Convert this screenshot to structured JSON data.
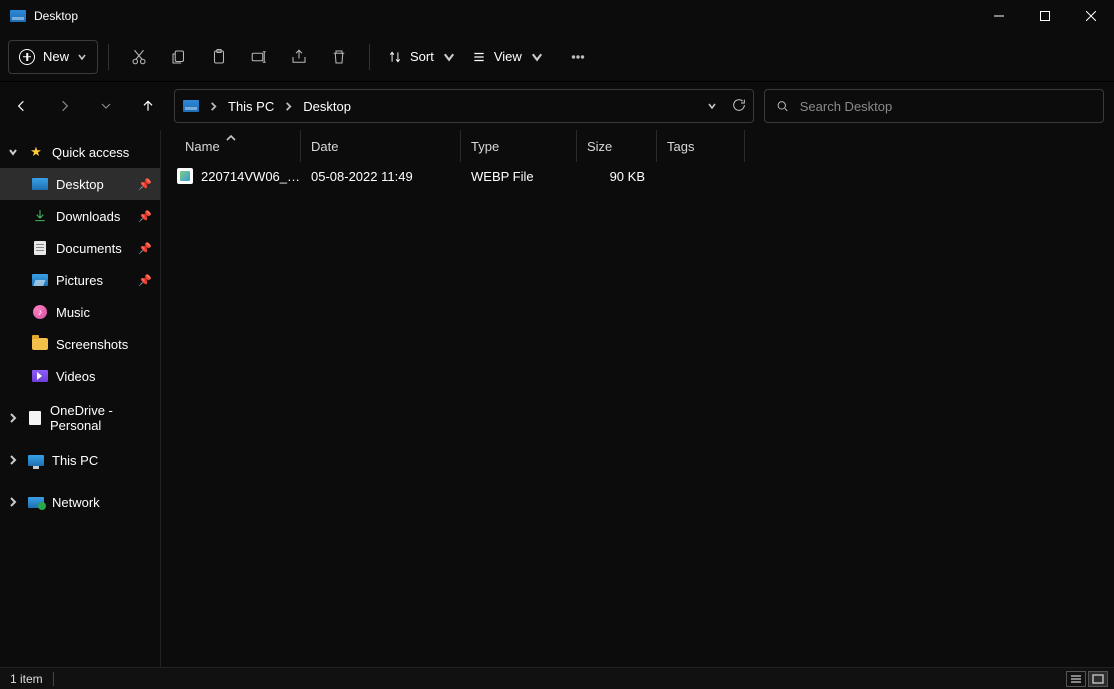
{
  "title": "Desktop",
  "toolbar": {
    "new_label": "New",
    "sort_label": "Sort",
    "view_label": "View"
  },
  "breadcrumbs": [
    "This PC",
    "Desktop"
  ],
  "search": {
    "placeholder": "Search Desktop"
  },
  "sidebar": {
    "quick_access": "Quick access",
    "items": [
      {
        "label": "Desktop",
        "pinned": true
      },
      {
        "label": "Downloads",
        "pinned": true
      },
      {
        "label": "Documents",
        "pinned": true
      },
      {
        "label": "Pictures",
        "pinned": true
      },
      {
        "label": "Music",
        "pinned": false
      },
      {
        "label": "Screenshots",
        "pinned": false
      },
      {
        "label": "Videos",
        "pinned": false
      }
    ],
    "onedrive": "OneDrive - Personal",
    "this_pc": "This PC",
    "network": "Network"
  },
  "columns": {
    "name": "Name",
    "date": "Date",
    "type": "Type",
    "size": "Size",
    "tags": "Tags"
  },
  "files": [
    {
      "name": "220714VW06_ID4_Dr...",
      "date": "05-08-2022 11:49",
      "type": "WEBP File",
      "size": "90 KB",
      "tags": ""
    }
  ],
  "status": {
    "count": "1 item"
  }
}
